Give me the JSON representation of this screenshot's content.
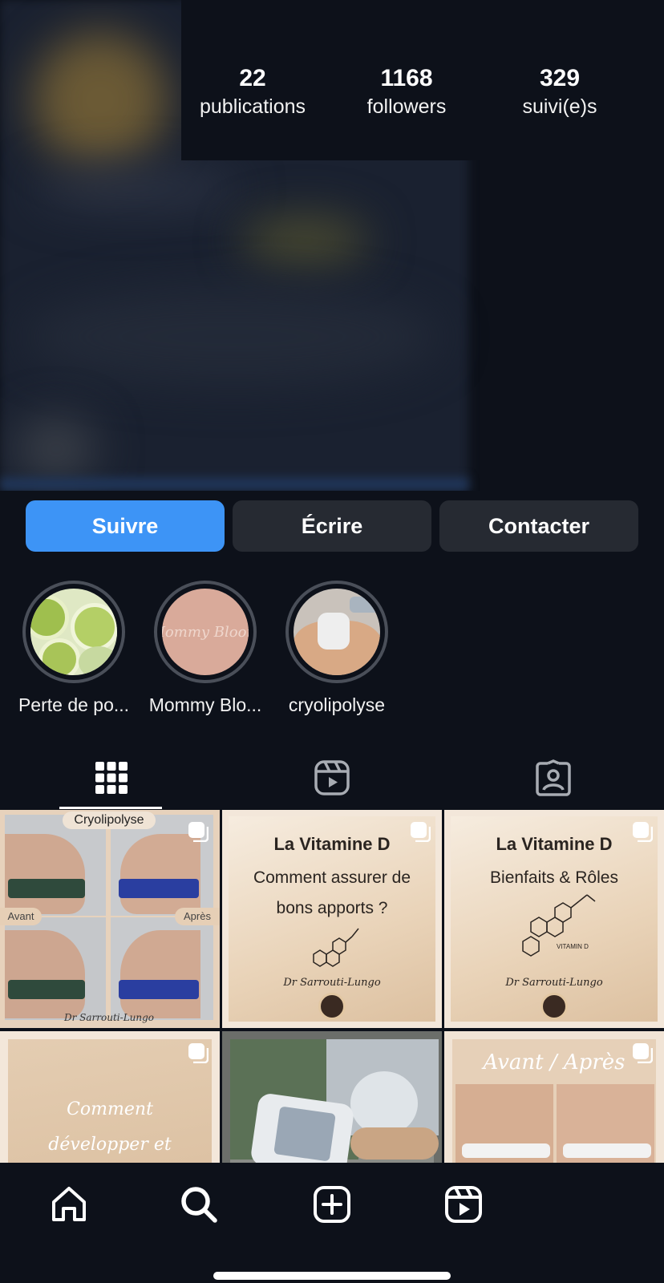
{
  "profile": {
    "stats": [
      {
        "value": "22",
        "label": "publications"
      },
      {
        "value": "1168",
        "label": "followers"
      },
      {
        "value": "329",
        "label": "suivi(e)s"
      }
    ]
  },
  "actions": {
    "follow": "Suivre",
    "message": "Écrire",
    "contact": "Contacter"
  },
  "highlights": [
    {
      "label": "Perte de po..."
    },
    {
      "label": "Mommy Blo...",
      "cover_text": "Mommy Bloom"
    },
    {
      "label": "cryolipolyse"
    }
  ],
  "tabs": {
    "active": "grid",
    "items": [
      "grid-icon",
      "reels-icon",
      "tagged-icon"
    ]
  },
  "posts": [
    {
      "type": "before-after",
      "badge": "Cryolipolyse",
      "before": "Avant",
      "after": "Après",
      "signature": "Dr Sarrouti-Lungo",
      "multi": true
    },
    {
      "type": "card",
      "title": "La Vitamine D",
      "subtitle": "Comment assurer de bons apports ?",
      "signature": "Dr Sarrouti-Lungo",
      "multi": true
    },
    {
      "type": "card",
      "title": "La Vitamine D",
      "subtitle": "Bienfaits & Rôles",
      "molecule_label": "VITAMIN D",
      "signature": "Dr Sarrouti-Lungo",
      "multi": true
    },
    {
      "type": "card",
      "script": "Comment développer et tonifier sa musculature",
      "multi": true
    },
    {
      "type": "photo",
      "multi": false
    },
    {
      "type": "before-after",
      "script": "Avant / Après",
      "multi": true
    }
  ],
  "nav": {
    "items": [
      "home-icon",
      "search-icon",
      "create-icon",
      "reels-icon"
    ]
  },
  "colors": {
    "background": "#0d111a",
    "primary_button": "#3d94f6",
    "secondary_button": "#262a32",
    "card_beige": "#f3e7da"
  }
}
